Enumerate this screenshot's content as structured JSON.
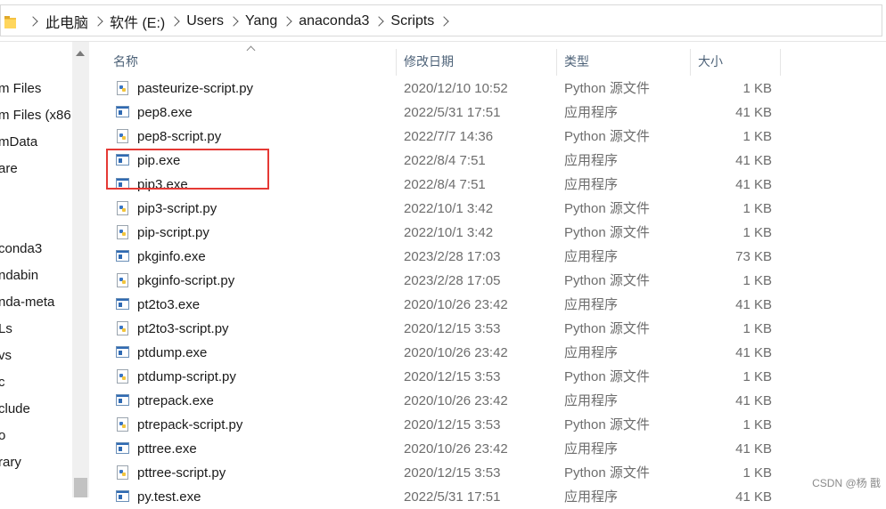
{
  "breadcrumb": [
    "此电脑",
    "软件 (E:)",
    "Users",
    "Yang",
    "anaconda3",
    "Scripts"
  ],
  "nav": {
    "items": [
      "m Files",
      "m Files (x86",
      "mData",
      "are",
      "",
      "conda3",
      "ndabin",
      "nda-meta",
      "Ls",
      "vs",
      "c",
      "clude",
      "o",
      "rary"
    ]
  },
  "columns": {
    "name": "名称",
    "date": "修改日期",
    "type": "类型",
    "size": "大小"
  },
  "files": [
    {
      "name": "pasteurize-script.py",
      "date": "2020/12/10 10:52",
      "type": "Python 源文件",
      "size": "1 KB",
      "icon": "python-file-icon"
    },
    {
      "name": "pep8.exe",
      "date": "2022/5/31 17:51",
      "type": "应用程序",
      "size": "41 KB",
      "icon": "exe-file-icon"
    },
    {
      "name": "pep8-script.py",
      "date": "2022/7/7 14:36",
      "type": "Python 源文件",
      "size": "1 KB",
      "icon": "python-file-icon"
    },
    {
      "name": "pip.exe",
      "date": "2022/8/4 7:51",
      "type": "应用程序",
      "size": "41 KB",
      "icon": "exe-file-icon"
    },
    {
      "name": "pip3.exe",
      "date": "2022/8/4 7:51",
      "type": "应用程序",
      "size": "41 KB",
      "icon": "exe-file-icon"
    },
    {
      "name": "pip3-script.py",
      "date": "2022/10/1 3:42",
      "type": "Python 源文件",
      "size": "1 KB",
      "icon": "python-file-icon"
    },
    {
      "name": "pip-script.py",
      "date": "2022/10/1 3:42",
      "type": "Python 源文件",
      "size": "1 KB",
      "icon": "python-file-icon"
    },
    {
      "name": "pkginfo.exe",
      "date": "2023/2/28 17:03",
      "type": "应用程序",
      "size": "73 KB",
      "icon": "exe-file-icon"
    },
    {
      "name": "pkginfo-script.py",
      "date": "2023/2/28 17:05",
      "type": "Python 源文件",
      "size": "1 KB",
      "icon": "python-file-icon"
    },
    {
      "name": "pt2to3.exe",
      "date": "2020/10/26 23:42",
      "type": "应用程序",
      "size": "41 KB",
      "icon": "exe-file-icon"
    },
    {
      "name": "pt2to3-script.py",
      "date": "2020/12/15 3:53",
      "type": "Python 源文件",
      "size": "1 KB",
      "icon": "python-file-icon"
    },
    {
      "name": "ptdump.exe",
      "date": "2020/10/26 23:42",
      "type": "应用程序",
      "size": "41 KB",
      "icon": "exe-file-icon"
    },
    {
      "name": "ptdump-script.py",
      "date": "2020/12/15 3:53",
      "type": "Python 源文件",
      "size": "1 KB",
      "icon": "python-file-icon"
    },
    {
      "name": "ptrepack.exe",
      "date": "2020/10/26 23:42",
      "type": "应用程序",
      "size": "41 KB",
      "icon": "exe-file-icon"
    },
    {
      "name": "ptrepack-script.py",
      "date": "2020/12/15 3:53",
      "type": "Python 源文件",
      "size": "1 KB",
      "icon": "python-file-icon"
    },
    {
      "name": "pttree.exe",
      "date": "2020/10/26 23:42",
      "type": "应用程序",
      "size": "41 KB",
      "icon": "exe-file-icon"
    },
    {
      "name": "pttree-script.py",
      "date": "2020/12/15 3:53",
      "type": "Python 源文件",
      "size": "1 KB",
      "icon": "python-file-icon"
    },
    {
      "name": "py.test.exe",
      "date": "2022/5/31 17:51",
      "type": "应用程序",
      "size": "41 KB",
      "icon": "exe-file-icon"
    }
  ],
  "highlight_color": "#e53935",
  "watermark": "CSDN @杨 戬"
}
